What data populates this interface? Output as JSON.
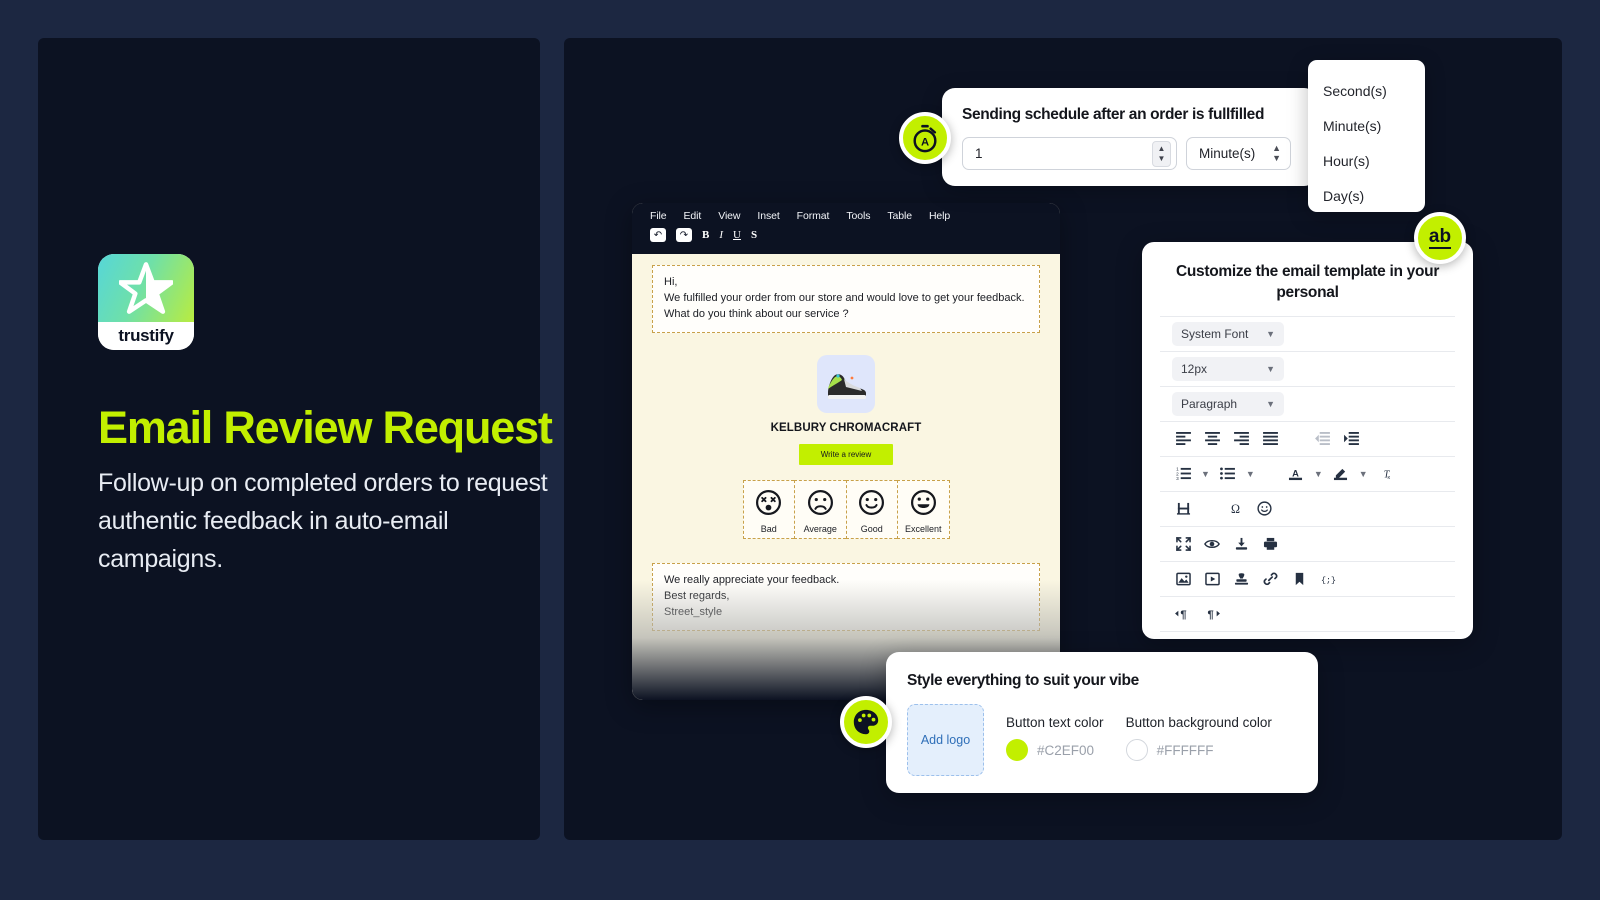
{
  "brand": {
    "logo_word": "trustify",
    "logo_icon": "star-icon",
    "accent_color": "#C2EF00",
    "panel_bg": "#0C1222",
    "page_bg": "#1C2741"
  },
  "hero": {
    "title": "Email Review Request",
    "subtitle": "Follow-up on completed orders to request authentic feedback in auto-email campaigns."
  },
  "schedule": {
    "badge_icon": "stopwatch-icon",
    "title": "Sending schedule after an order is fullfilled",
    "amount_value": "1",
    "amount_placeholder": "1",
    "unit_value": "Minute(s)",
    "stepper_icon": "stepper-up-down-icon",
    "unit_caret_icon": "chevron-up-down-icon",
    "dropdown_options": [
      "Second(s)",
      "Minute(s)",
      "Hour(s)",
      "Day(s)"
    ]
  },
  "editor": {
    "menu": [
      "File",
      "Edit",
      "View",
      "Inset",
      "Format",
      "Tools",
      "Table",
      "Help"
    ],
    "toolbar": [
      {
        "name": "undo-icon",
        "glyph": "↶"
      },
      {
        "name": "redo-icon",
        "glyph": "↷"
      },
      {
        "name": "bold-icon",
        "glyph": "B"
      },
      {
        "name": "italic-icon",
        "glyph": "I"
      },
      {
        "name": "underline-icon",
        "glyph": "U"
      },
      {
        "name": "strikethrough-icon",
        "glyph": "S"
      }
    ],
    "greeting": "Hi,\nWe fulfilled your order from our store and would love to get your feedback. What do you think about our service ?",
    "product_name": "KELBURY CHROMACRAFT",
    "product_image_icon": "sneaker-image",
    "review_button_label": "Write a review",
    "ratings": [
      {
        "label": "Bad",
        "face": "dizzy-face-icon"
      },
      {
        "label": "Average",
        "face": "frowning-face-icon"
      },
      {
        "label": "Good",
        "face": "slight-smile-face-icon"
      },
      {
        "label": "Excellent",
        "face": "grinning-face-icon"
      }
    ],
    "closing": "We really appreciate your feedback.\nBest regards,\nStreet_style"
  },
  "customize": {
    "badge_label": "ab",
    "badge_icon": "text-format-icon",
    "title": "Customize the email template in your personal",
    "font_select": "System Font",
    "size_select": "12px",
    "block_select": "Paragraph",
    "rows": [
      [
        "align-left-icon",
        "align-center-icon",
        "align-right-icon",
        "align-justify-icon",
        "outdent-icon",
        "indent-icon"
      ],
      [
        "numbered-list-icon",
        "bulleted-list-icon",
        "text-color-icon",
        "highlight-color-icon",
        "clear-formatting-icon"
      ],
      [
        "horizontal-rule-icon",
        "special-character-icon",
        "emoji-icon"
      ],
      [
        "fullscreen-icon",
        "preview-icon",
        "export-icon",
        "print-icon"
      ],
      [
        "insert-image-icon",
        "insert-video-icon",
        "stamp-icon",
        "link-icon",
        "bookmark-icon",
        "code-sample-icon"
      ],
      [
        "ltr-direction-icon",
        "rtl-direction-icon"
      ]
    ]
  },
  "style": {
    "badge_icon": "palette-icon",
    "title": "Style everything to suit your vibe",
    "add_logo_label": "Add logo",
    "button_text_color_label": "Button text color",
    "button_text_color_value": "#C2EF00",
    "button_bg_color_label": "Button background color",
    "button_bg_color_value": "#FFFFFF"
  }
}
